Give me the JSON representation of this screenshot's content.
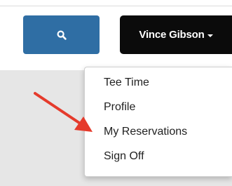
{
  "header": {
    "search_icon": "search-icon",
    "user_name": "Vince Gibson",
    "dropdown_icon": "caret-down-icon"
  },
  "colors": {
    "search_button": "#2f6ea4",
    "user_button": "#0b0b0b",
    "arrow": "#e53b2c",
    "backdrop": "#e6e6e6"
  },
  "menu": {
    "items": [
      {
        "label": "Tee Time"
      },
      {
        "label": "Profile"
      },
      {
        "label": "My Reservations"
      },
      {
        "label": "Sign Off"
      }
    ]
  },
  "annotation": {
    "arrow_target": "My Reservations"
  }
}
